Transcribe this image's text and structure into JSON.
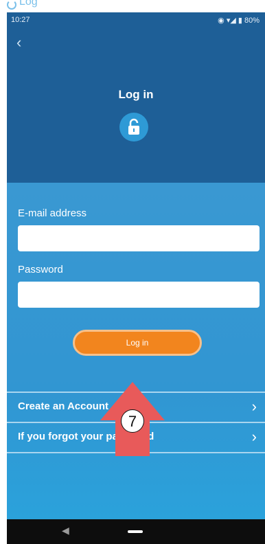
{
  "colors": {
    "header_bg": "#1e5f97",
    "body_bg": "#3196d2",
    "accent_orange": "#f2851e",
    "arrow_red": "#e85a5a"
  },
  "top_strip": {
    "text": "Log"
  },
  "status_bar": {
    "time": "10:27",
    "right": "◉ ▾◢ ▮ 80%"
  },
  "header": {
    "back_icon": "chevron-left-icon",
    "title": "Log in",
    "lock_icon": "lock-icon"
  },
  "form": {
    "email_label": "E-mail address",
    "email_value": "",
    "password_label": "Password",
    "password_value": ""
  },
  "login_button": {
    "label": "Log in"
  },
  "rows": [
    {
      "label": "Create an Account"
    },
    {
      "label": "If you forgot your password"
    }
  ],
  "annotation": {
    "step": "7"
  },
  "navbar": {
    "back": "◀"
  }
}
